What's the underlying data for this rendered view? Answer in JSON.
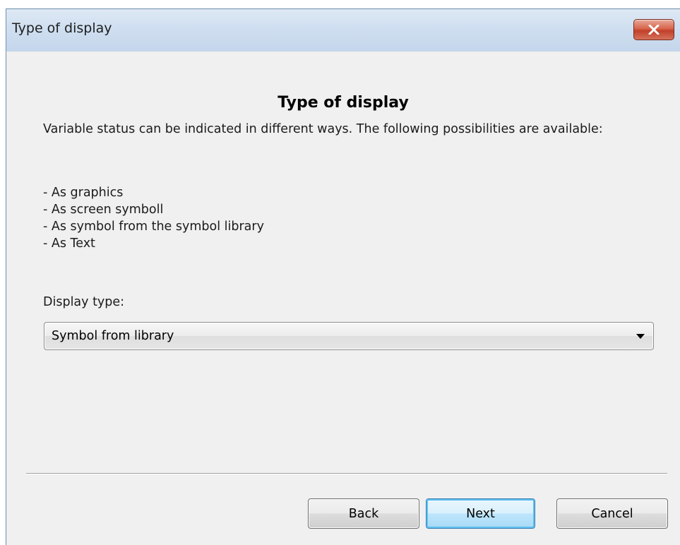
{
  "window": {
    "title": "Type of display",
    "close_icon": "close-x-icon"
  },
  "content": {
    "heading": "Type of display",
    "description": "Variable status can be indicated in different ways. The following possibilities are available:",
    "options": [
      "- As graphics",
      "- As screen symboll",
      "- As symbol from the symbol library",
      "- As Text"
    ],
    "display_type_label": "Display type:",
    "display_type_value": "Symbol from library"
  },
  "buttons": {
    "back": "Back",
    "next": "Next",
    "cancel": "Cancel"
  },
  "colors": {
    "titlebar": "#c4d6eb",
    "close_button": "#c1402a",
    "background": "#f0f0f0",
    "default_button_border": "#3c7fb1"
  }
}
